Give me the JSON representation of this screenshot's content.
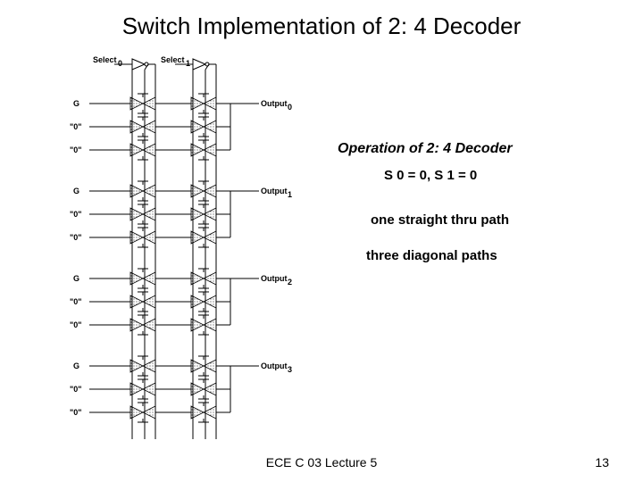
{
  "title": "Switch Implementation of 2: 4 Decoder",
  "footer_center": "ECE C 03 Lecture 5",
  "footer_page": "13",
  "right_panel": {
    "heading": "Operation of 2: 4 Decoder",
    "line1": "S 0 = 0,  S 1 = 0",
    "line2": "one straight thru path",
    "line3": "three diagonal paths"
  },
  "diagram": {
    "sel0": "Select",
    "sel0_sub": "0",
    "sel1": "Select",
    "sel1_sub": "1",
    "G": "G",
    "zero": "\"0\"",
    "out": "Output",
    "out_subs": [
      "0",
      "1",
      "2",
      "3"
    ]
  },
  "chart_data": {
    "type": "diagram",
    "description": "Transistor-level switch network implementing a 2-to-4 decoder",
    "inputs": [
      "Select0",
      "Select1",
      "G"
    ],
    "outputs": [
      "Output0",
      "Output1",
      "Output2",
      "Output3"
    ],
    "left_row_labels": [
      "G",
      "\"0\"",
      "\"0\"",
      "G",
      "\"0\"",
      "\"0\"",
      "G",
      "\"0\"",
      "\"0\"",
      "G",
      "\"0\"",
      "\"0\""
    ],
    "case_shown": {
      "S0": 0,
      "S1": 0
    },
    "paths": {
      "straight_thru": 1,
      "diagonal": 3
    }
  }
}
